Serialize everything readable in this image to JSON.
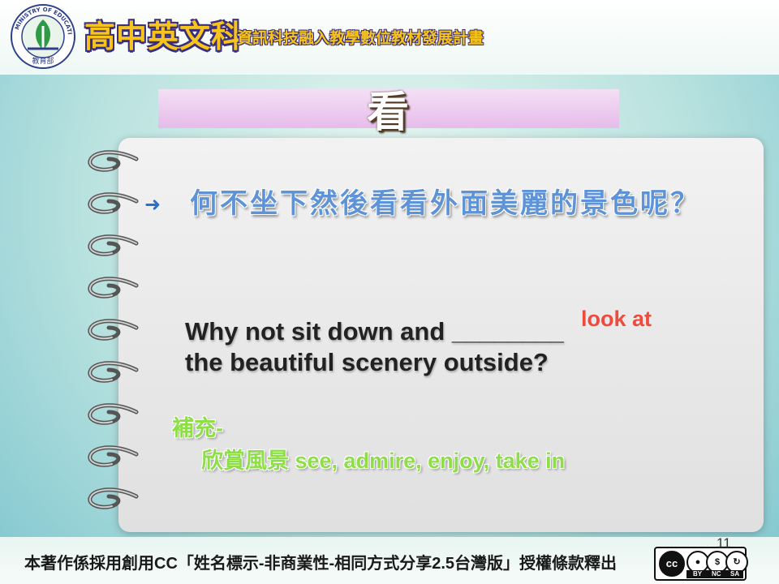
{
  "header": {
    "logo_text": "MINISTRY OF EDUCATION",
    "logo_caption": "教育部",
    "title": "高中英文科",
    "subtitle": "資訊科技融入教學數位教材發展計畫"
  },
  "slide": {
    "heading": "看",
    "question": "何不坐下然後看看外面美麗的景色呢？",
    "sentence_line1": "Why not sit down and ________",
    "sentence_line2": "the beautiful scenery outside?",
    "answer": "look at",
    "supplement_label": "補充-",
    "supplement_text": "欣賞風景 see, admire, enjoy, take in",
    "page_number": "11"
  },
  "footer": {
    "license_text": "本著作係採用創用CC「姓名標示-非商業性-相同方式分享2.5台灣版」授權條款釋出",
    "cc_main": "cc",
    "cc_labels": [
      "BY",
      "NC",
      "SA"
    ]
  },
  "colors": {
    "title": "#f6c41d",
    "question": "#5e93d8",
    "answer": "#ef4a3c",
    "supplement": "#8ede48"
  }
}
